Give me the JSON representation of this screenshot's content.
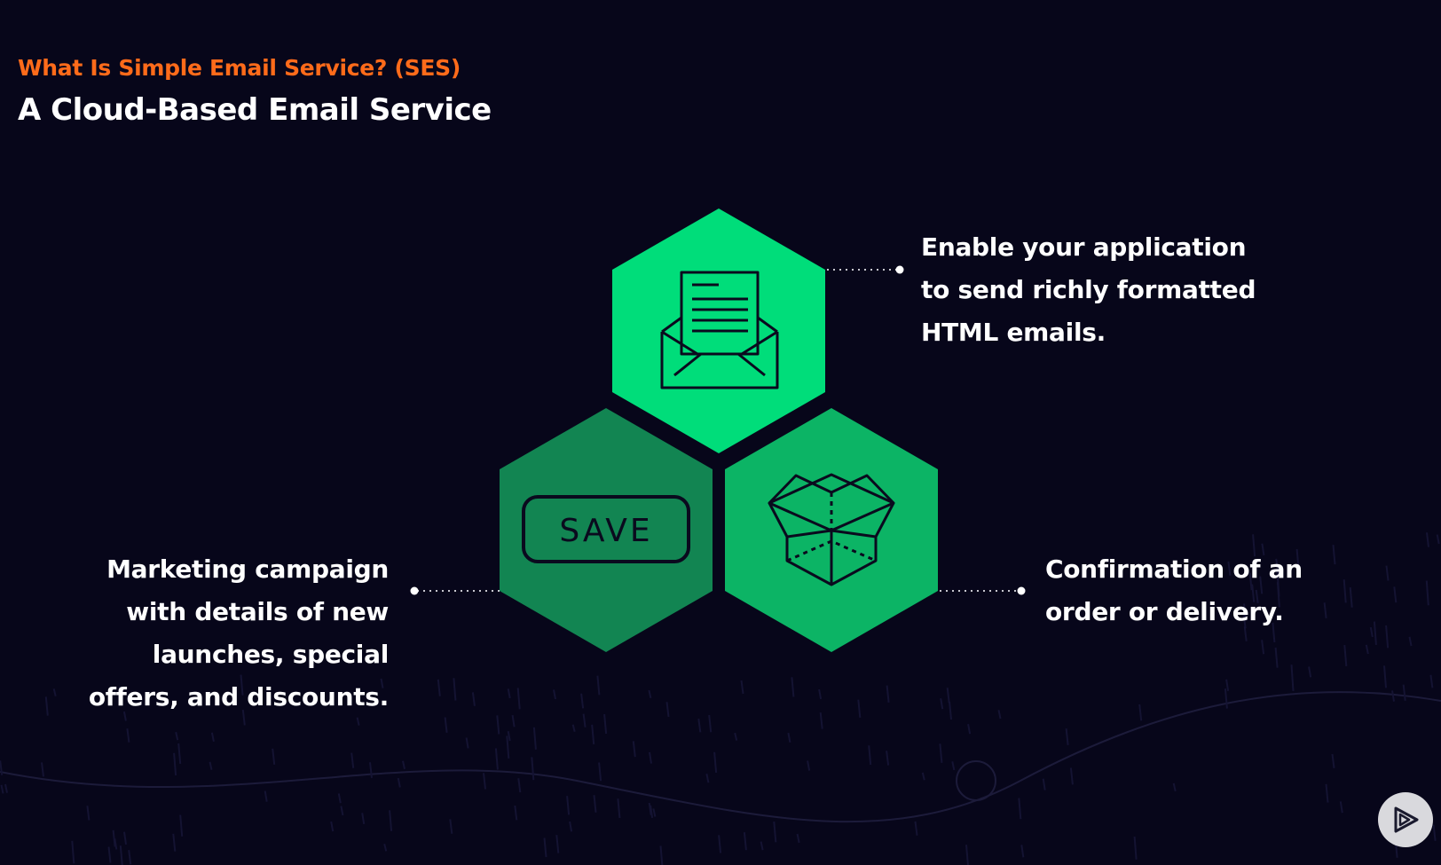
{
  "header": {
    "eyebrow": "What Is Simple Email Service? (SES)",
    "title": "A Cloud-Based Email Service"
  },
  "diagram": {
    "top": {
      "icon": "envelope-letter-icon",
      "color": "#00dd7a",
      "description": "Enable your application\nto send richly formatted\nHTML emails."
    },
    "bottom_left": {
      "icon": "save-button-icon",
      "icon_text": "SAVE",
      "color": "#128552",
      "description": "Marketing campaign\nwith details of new\nlaunches, special\noffers, and discounts."
    },
    "bottom_right": {
      "icon": "open-box-icon",
      "color": "#0cb465",
      "description": "Confirmation of an\norder or delivery."
    }
  },
  "colors": {
    "background": "#07061a",
    "accent": "#ff6b1a",
    "text": "#ffffff",
    "connector": "#c8c8d0"
  },
  "controls": {
    "play_icon": "play-logo-icon"
  }
}
